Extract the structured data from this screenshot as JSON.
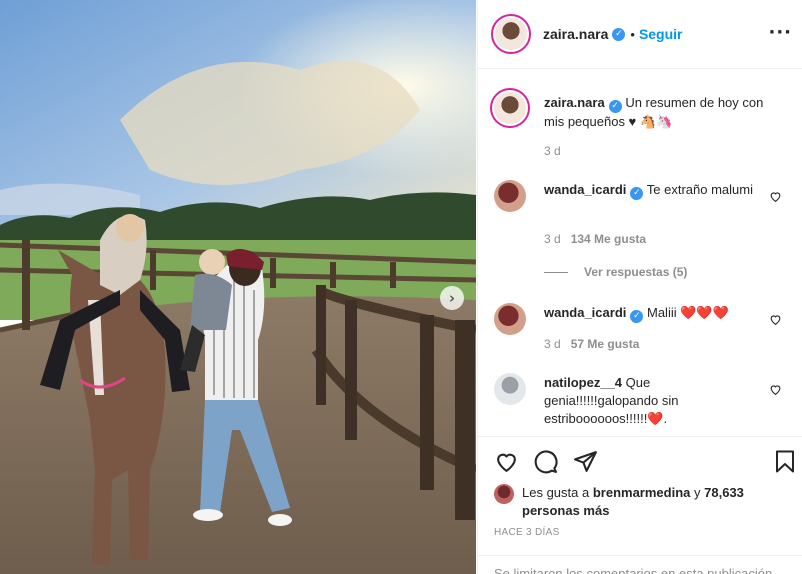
{
  "post": {
    "username": "zaira.nara",
    "separator": "•",
    "follow_label": "Seguir",
    "more_label": "···",
    "caption": "Un resumen de hoy con mis pequeños ♥",
    "caption_time": "3 d"
  },
  "comments": [
    {
      "username": "wanda_icardi",
      "text": "Te extraño malumi",
      "time": "3 d",
      "likes": "134 Me gusta",
      "replies": "Ver respuestas (5)"
    },
    {
      "username": "wanda_icardi",
      "text": "Maliii",
      "hearts": "❤️❤️❤️",
      "time": "3 d",
      "likes": "57 Me gusta"
    },
    {
      "username": "natilopez__4",
      "text": "Que genia!!!!!!galopando sin estriboooooos!!!!!!",
      "heart": "❤️",
      "end": "."
    }
  ],
  "likes_summary": {
    "prefix": "Les gusta a",
    "user": "brenmarmedina",
    "conj": "y",
    "others": "78,633 personas más"
  },
  "timestamp": "HACE 3 DÍAS",
  "comments_closed": "Se limitaron los comentarios en esta publicación.",
  "icons": [
    "heart-icon",
    "comment-icon",
    "share-icon",
    "bookmark-icon",
    "chevron-right-icon",
    "verified-badge-icon",
    "more-options-icon"
  ],
  "colors": {
    "accent": "#0095f6",
    "verified": "#3897f0",
    "muted": "#8e8e8e",
    "border": "#efefef",
    "heart": "#ed4956"
  }
}
